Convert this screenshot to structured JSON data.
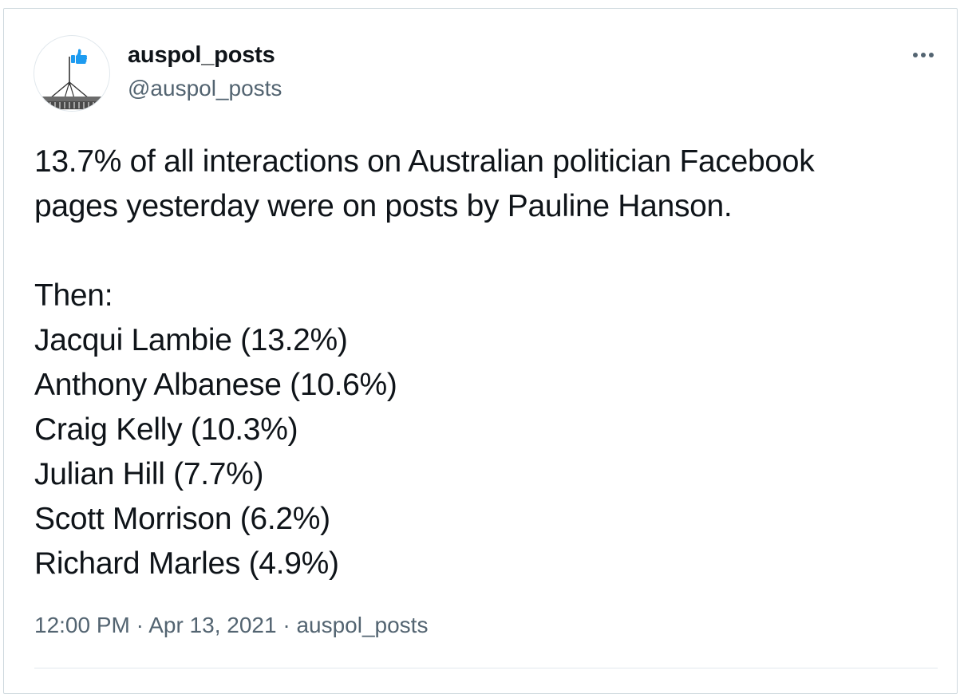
{
  "user": {
    "display_name": "auspol_posts",
    "handle": "@auspol_posts",
    "avatar_icon": "parliament-house-thumbs-up-icon"
  },
  "tweet": {
    "lines": [
      "13.7% of all interactions on Australian politician Facebook",
      "pages yesterday were on posts by Pauline Hanson.",
      "",
      "Then:",
      "Jacqui Lambie (13.2%)",
      "Anthony Albanese (10.6%)",
      "Craig Kelly (10.3%)",
      "Julian Hill (7.7%)",
      "Scott Morrison (6.2%)",
      "Richard Marles (4.9%)"
    ],
    "time": "12:00 PM",
    "separator": " · ",
    "date": "Apr 13, 2021",
    "source": "auspol_posts"
  },
  "more_icon": "more-options-icon",
  "colors": {
    "text_primary": "#0f1419",
    "text_secondary": "#536471",
    "border": "#cfd9de",
    "accent": "#1d9bf0"
  }
}
